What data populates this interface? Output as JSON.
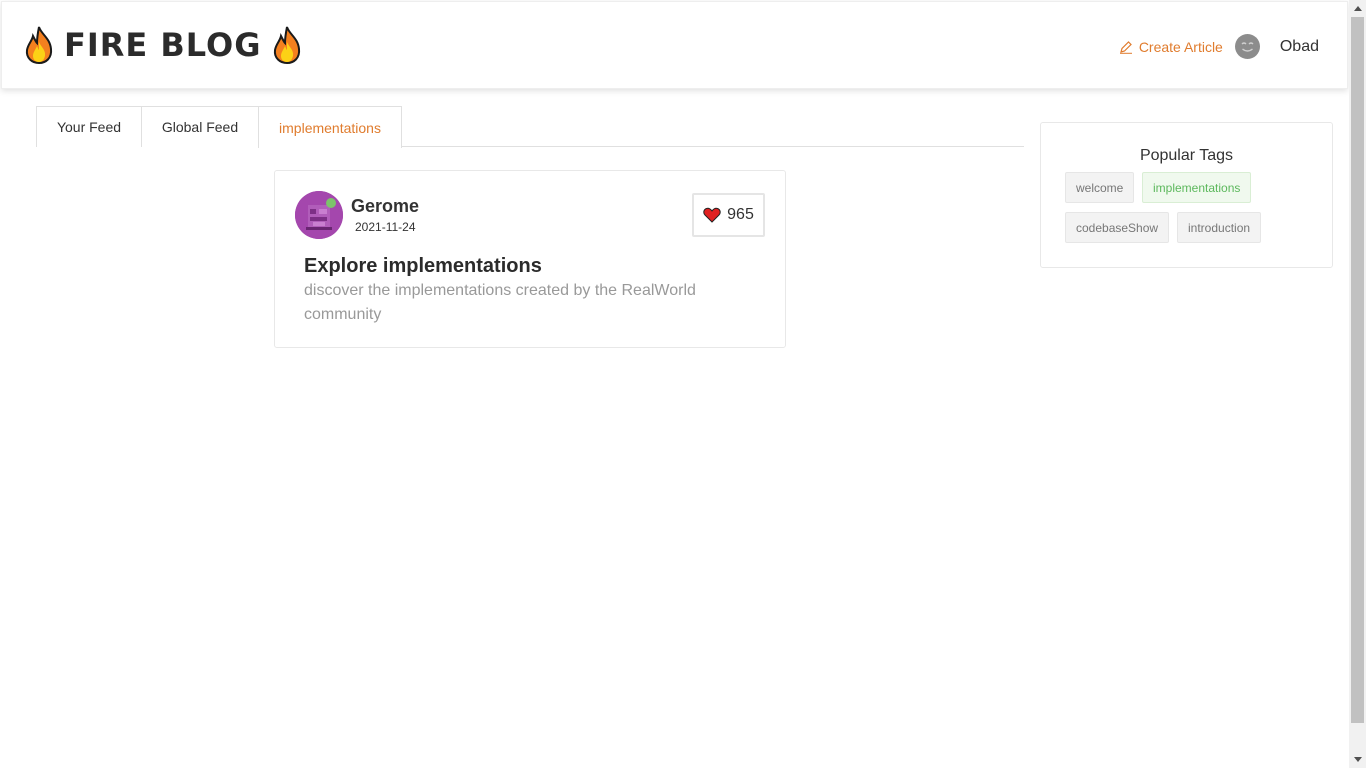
{
  "header": {
    "logo_text": "FIRE BLOG",
    "create_article_label": "Create Article",
    "username": "Obad"
  },
  "tabs": [
    {
      "label": "Your Feed",
      "active": false
    },
    {
      "label": "Global Feed",
      "active": false
    },
    {
      "label": "implementations",
      "active": true
    }
  ],
  "article": {
    "author": "Gerome",
    "date": "2021-11-24",
    "likes": "965",
    "title": "Explore implementations",
    "description": "discover the implementations created by the RealWorld community"
  },
  "sidebar": {
    "title": "Popular Tags",
    "tags": [
      {
        "label": "welcome",
        "active": false
      },
      {
        "label": "implementations",
        "active": true
      },
      {
        "label": "codebaseShow",
        "active": false
      },
      {
        "label": "introduction",
        "active": false
      }
    ]
  },
  "colors": {
    "accent": "#e07c2e",
    "tag_active": "#5cb85c",
    "heart": "#e02020",
    "avatar": "#a447ad"
  }
}
